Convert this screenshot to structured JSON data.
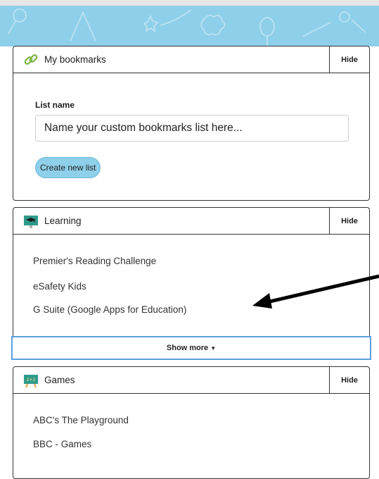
{
  "bookmarks_panel": {
    "title": "My bookmarks",
    "hide_label": "Hide",
    "list_name_label": "List name",
    "list_name_placeholder": "Name your custom bookmarks list here...",
    "create_button_label": "Create new list"
  },
  "learning_panel": {
    "title": "Learning",
    "hide_label": "Hide",
    "links": [
      {
        "label": "Premier's Reading Challenge"
      },
      {
        "label": "eSafety Kids"
      },
      {
        "label": "G Suite (Google Apps for Education)"
      }
    ],
    "show_more_label": "Show more"
  },
  "games_panel": {
    "title": "Games",
    "hide_label": "Hide",
    "links": [
      {
        "label": "ABC's The Playground"
      },
      {
        "label": "BBC - Games"
      }
    ]
  },
  "colors": {
    "banner": "#8ecfe9",
    "create_button": "#8ecfe9",
    "show_more_border": "#5aa0e0"
  },
  "icons": {
    "bookmarks": "link-chain-icon",
    "learning": "graduation-cap-board-icon",
    "games": "game-board-icon",
    "show_more": "caret-down-icon"
  }
}
